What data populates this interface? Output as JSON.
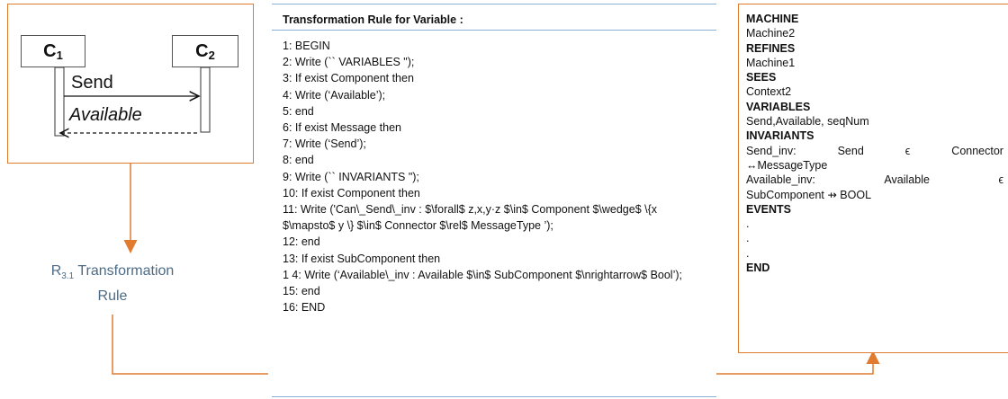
{
  "sequence_diagram": {
    "component1": "C",
    "component1_sub": "1",
    "component2": "C",
    "component2_sub": "2",
    "message_send": "Send",
    "message_available": "Available"
  },
  "rule_label": {
    "prefix": "R",
    "subscript": "3.1",
    "line1": "Transformation",
    "line2": "Rule"
  },
  "code_panel": {
    "title": "Transformation Rule for Variable :",
    "lines": [
      "1: BEGIN",
      "2: Write (`` VARIABLES \");",
      "3: If exist Component then",
      "4: Write (‘Available’);",
      "5: end",
      "6: If exist Message then",
      "7: Write (‘Send’);",
      "8: end",
      "9: Write (`` INVARIANTS \");",
      "10: If exist Component then",
      "11: Write ('Can\\_Send\\_inv : $\\forall$ z,x,y·z $\\in$ Component $\\wedge$ \\{x $\\mapsto$ y \\} $\\in$ Connector $\\rel$ MessageType ’);",
      "12: end",
      "13: If exist SubComponent then",
      "1 4: Write (‘Available\\_inv : Available $\\in$ SubComponent $\\nrightarrow$ Bool’);",
      "15: end",
      "16: END"
    ]
  },
  "machine_panel": {
    "kw_machine": "MACHINE",
    "machine_name": "Machine2",
    "kw_refines": "REFINES",
    "refines_name": "Machine1",
    "kw_sees": "SEES",
    "sees_name": "Context2",
    "kw_variables": "VARIABLES",
    "variables": "Send,Available, seqNum",
    "kw_invariants": "INVARIANTS",
    "inv1_a": "Send_inv:",
    "inv1_b": "Send",
    "inv1_c": "ϵ",
    "inv1_d": "Connector",
    "inv1_e": "↔MessageType",
    "inv2_a": "Available_inv:",
    "inv2_b": "Available",
    "inv2_c": "ϵ",
    "inv2_d": "SubComponent ⇸ BOOL",
    "kw_events": "EVENTS",
    "dot1": ".",
    "dot2": ".",
    "dot3": ".",
    "kw_end": "END"
  }
}
